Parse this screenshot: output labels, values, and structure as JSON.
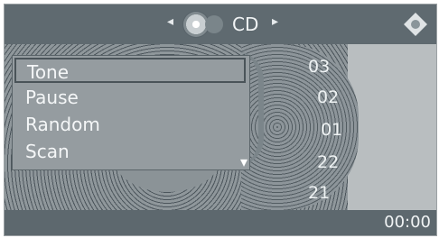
{
  "top_bar": {
    "source": "CD",
    "left_arrow": "◂",
    "right_arrow": "▸",
    "icons": [
      "disc-icon",
      "nav-pad-icon"
    ]
  },
  "menu": {
    "items": [
      {
        "label": "Tone",
        "selected": true
      },
      {
        "label": "Pause",
        "selected": false
      },
      {
        "label": "Random",
        "selected": false
      },
      {
        "label": "Scan",
        "selected": false
      }
    ],
    "scroll_indicator": "▾"
  },
  "tracks": [
    "03",
    "02",
    "01",
    "22",
    "21"
  ],
  "status": {
    "time": "00:00"
  },
  "colors": {
    "top_bar": "#5f6a70",
    "panel": "#b9bec0",
    "menu_bg": "#959ca0"
  }
}
